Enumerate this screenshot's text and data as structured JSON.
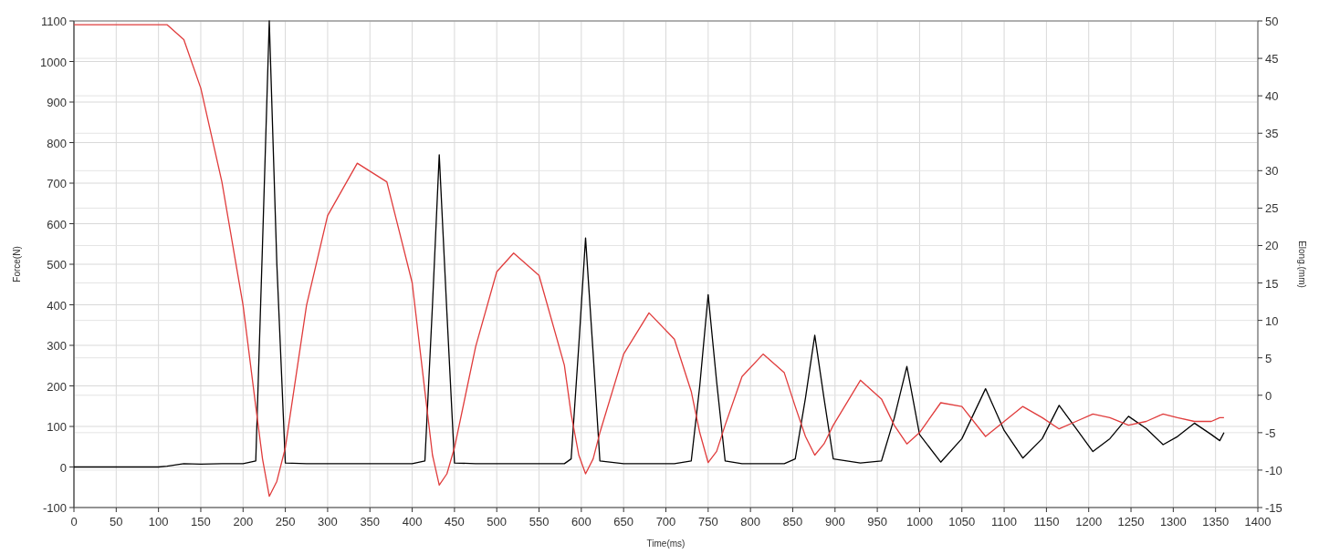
{
  "chart": {
    "chart_data": {
      "type": "line",
      "xlabel": "Time(ms)",
      "ylabel": "Force(N)",
      "y2label": "Elong.(mm)",
      "x": [
        0,
        50,
        100,
        110,
        130,
        150,
        175,
        200,
        215,
        223,
        231,
        240,
        250,
        275,
        300,
        335,
        370,
        400,
        415,
        424,
        432,
        441,
        450,
        475,
        500,
        520,
        550,
        580,
        588,
        597,
        605,
        614,
        622,
        650,
        680,
        710,
        730,
        740,
        750,
        760,
        770,
        790,
        815,
        840,
        853,
        865,
        876,
        887,
        898,
        930,
        955,
        970,
        985,
        1000,
        1025,
        1050,
        1078,
        1100,
        1122,
        1145,
        1165,
        1185,
        1205,
        1225,
        1247,
        1268,
        1288,
        1305,
        1325,
        1345,
        1355,
        1360
      ],
      "series": [
        {
          "color": "#000000",
          "values": [
            0,
            0,
            0,
            2,
            8,
            7,
            8,
            8,
            15,
            550,
            1100,
            500,
            10,
            8,
            8,
            8,
            8,
            8,
            15,
            400,
            770,
            380,
            10,
            8,
            8,
            8,
            8,
            8,
            20,
            300,
            565,
            280,
            15,
            8,
            8,
            8,
            15,
            200,
            425,
            210,
            15,
            8,
            8,
            8,
            20,
            170,
            325,
            170,
            20,
            10,
            15,
            120,
            248,
            80,
            12,
            70,
            193,
            90,
            22,
            70,
            152,
            95,
            38,
            70,
            125,
            95,
            55,
            75,
            108,
            80,
            65,
            85
          ]
        },
        {
          "color": "#e03c3c",
          "axis": "y2",
          "values": [
            49.5,
            49.5,
            49.5,
            49.5,
            47.5,
            41,
            28.5,
            12,
            -1.5,
            -8.5,
            -13.5,
            -11.5,
            -7,
            12,
            24,
            31,
            28.5,
            15,
            0.5,
            -8,
            -12,
            -10.5,
            -7,
            6.5,
            16.5,
            19,
            16,
            4,
            -2.5,
            -8,
            -10.5,
            -8.5,
            -5,
            5.5,
            11,
            7.5,
            0.5,
            -5,
            -9,
            -7.5,
            -4,
            2.5,
            5.5,
            3,
            -1.5,
            -5.5,
            -8,
            -6.5,
            -4,
            2,
            -0.5,
            -4,
            -6.5,
            -5,
            -1,
            -1.5,
            -5.5,
            -3.5,
            -1.5,
            -3,
            -4.5,
            -3.5,
            -2.5,
            -3,
            -4,
            -3.5,
            -2.5,
            -3,
            -3.5,
            -3.5,
            -3,
            -3
          ]
        }
      ],
      "grid": true,
      "xlim": [
        0,
        1400
      ],
      "ylim": [
        -100,
        1100
      ],
      "y2lim": [
        -15,
        50
      ],
      "xticks": [
        0,
        50,
        100,
        150,
        200,
        250,
        300,
        350,
        400,
        450,
        500,
        550,
        600,
        650,
        700,
        750,
        800,
        850,
        900,
        950,
        1000,
        1050,
        1100,
        1150,
        1200,
        1250,
        1300,
        1350,
        1400
      ],
      "yticks": [
        -100,
        0,
        100,
        200,
        300,
        400,
        500,
        600,
        700,
        800,
        900,
        1000,
        1100
      ],
      "y2ticks": [
        -15,
        -10,
        -5,
        0,
        5,
        10,
        15,
        20,
        25,
        30,
        35,
        40,
        45,
        50
      ]
    }
  }
}
